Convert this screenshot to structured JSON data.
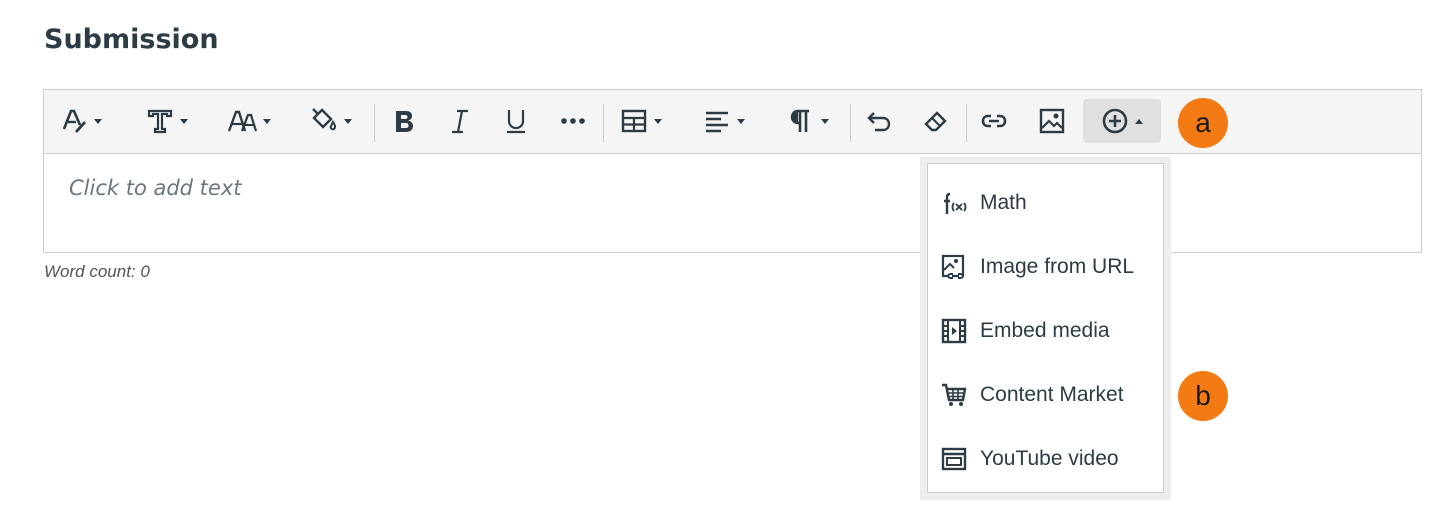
{
  "page": {
    "title": "Submission"
  },
  "toolbar": {
    "buttons": [
      {
        "icon": "font-color-icon",
        "dropdown": true
      },
      {
        "icon": "text-style-icon",
        "dropdown": true
      },
      {
        "icon": "font-size-icon",
        "dropdown": true
      },
      {
        "icon": "fill-color-icon",
        "dropdown": true
      },
      {
        "icon": "bold-icon"
      },
      {
        "icon": "italic-icon"
      },
      {
        "icon": "underline-icon"
      },
      {
        "icon": "more-icon"
      },
      {
        "icon": "table-icon",
        "dropdown": true
      },
      {
        "icon": "align-icon",
        "dropdown": true
      },
      {
        "icon": "paragraph-icon",
        "dropdown": true
      },
      {
        "icon": "undo-icon"
      },
      {
        "icon": "eraser-icon"
      },
      {
        "icon": "link-icon"
      },
      {
        "icon": "image-icon"
      },
      {
        "icon": "insert-plus-icon",
        "dropdown": true,
        "active": true
      }
    ]
  },
  "editor": {
    "placeholder": "Click to add text"
  },
  "footer": {
    "word_count": "Word count: 0"
  },
  "insert_menu": {
    "items": [
      {
        "label": "Math",
        "icon": "math-function-icon"
      },
      {
        "label": "Image from URL",
        "icon": "image-url-icon"
      },
      {
        "label": "Embed media",
        "icon": "film-icon"
      },
      {
        "label": "Content Market",
        "icon": "cart-icon"
      },
      {
        "label": "YouTube video",
        "icon": "video-window-icon"
      }
    ]
  },
  "annotations": {
    "a": "a",
    "b": "b"
  },
  "colors": {
    "accent": "#f47b14",
    "text": "#2d3b45",
    "border": "#c7cdd1",
    "toolbar_bg": "#f5f5f5"
  }
}
